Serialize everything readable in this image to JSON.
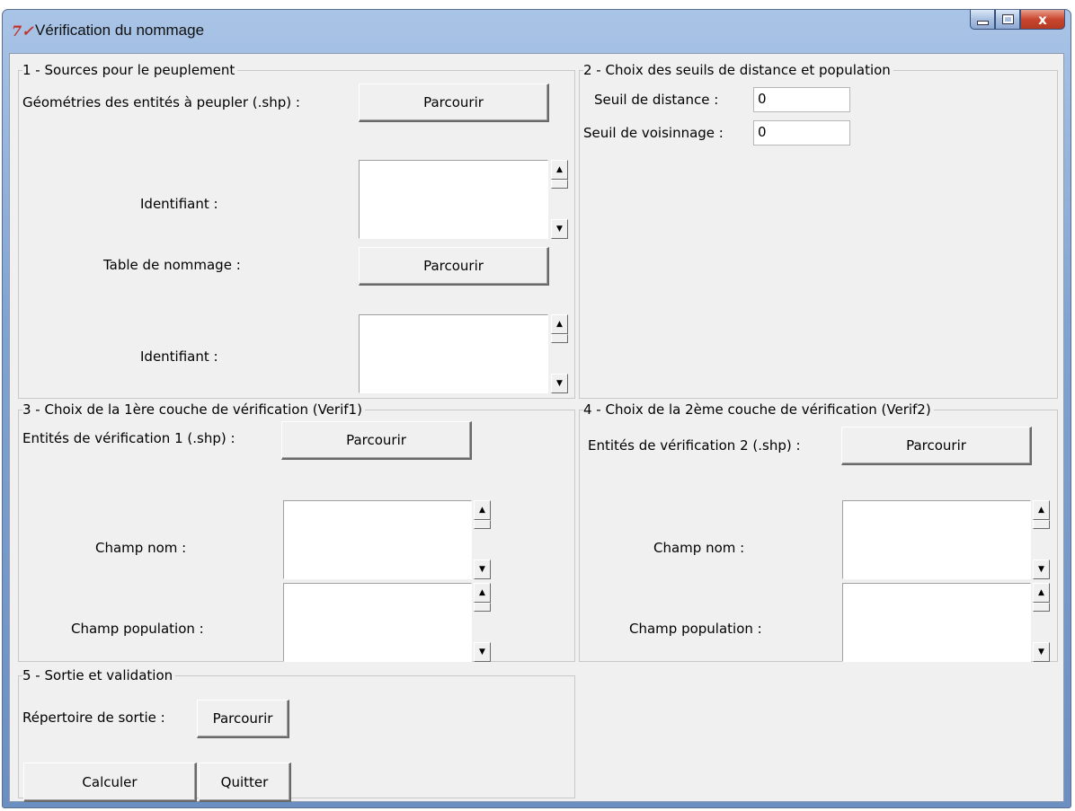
{
  "background": {
    "caption_fragment": ""
  },
  "window": {
    "title": "Vérification du nommage",
    "close_glyph": "x"
  },
  "section1": {
    "legend": "1 - Sources pour le peuplement",
    "geom_label": "Géométries des entités à peupler (.shp) :",
    "geom_button": "Parcourir",
    "id1_label": "Identifiant :",
    "table_label": "Table de nommage :",
    "table_button": "Parcourir",
    "id2_label": "Identifiant :"
  },
  "section2": {
    "legend": "2 - Choix des seuils de distance et population",
    "distance_label": "Seuil de distance :",
    "distance_value": "0",
    "voisinage_label": "Seuil de voisinnage :",
    "voisinage_value": "0"
  },
  "section3": {
    "legend": "3 - Choix de la 1ère couche de vérification (Verif1)",
    "entities_label": "Entités de vérification 1 (.shp) :",
    "entities_button": "Parcourir",
    "name_label": "Champ nom :",
    "pop_label": "Champ population :"
  },
  "section4": {
    "legend": "4 - Choix de la 2ème couche de vérification (Verif2)",
    "entities_label": "Entités de vérification 2 (.shp) :",
    "entities_button": "Parcourir",
    "name_label": "Champ nom :",
    "pop_label": "Champ population :"
  },
  "section5": {
    "legend": "5 - Sortie et validation",
    "output_label": "Répertoire de sortie :",
    "output_button": "Parcourir",
    "compute_button": "Calculer",
    "quit_button": "Quitter"
  },
  "icons": {
    "app": "tk-feather-icon",
    "scroll_up": "▲",
    "scroll_down": "▼"
  }
}
